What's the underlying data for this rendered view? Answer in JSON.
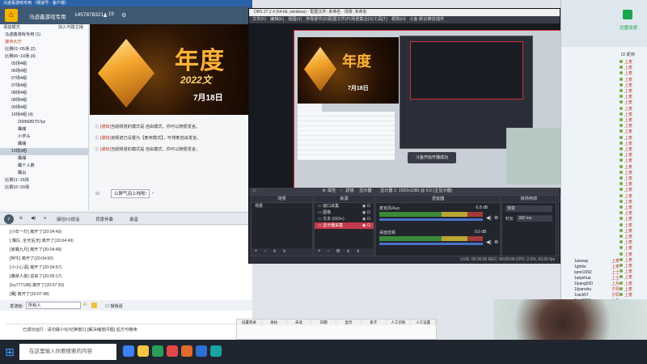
{
  "room": {
    "titlebar": "马迹看游戏专用 （频道号 - 客户端）",
    "name": "马迹鑫游戏专用",
    "room_id": "1457878321",
    "online_count": "19",
    "tree_header": "语音模式",
    "tree_header_right": "加入可踏主播",
    "tree": [
      {
        "label": "马迹鑫游戏专用 (1)",
        "cls": ""
      },
      {
        "label": "接待大厅",
        "cls": "red"
      },
      {
        "label": "比赛01~05场 (2)",
        "cls": ""
      },
      {
        "label": "比赛06~10场 (4)",
        "cls": ""
      },
      {
        "label": "05场4组",
        "cls": "sub"
      },
      {
        "label": "06场4组",
        "cls": "sub"
      },
      {
        "label": "07场4组",
        "cls": "sub"
      },
      {
        "label": "07场4组",
        "cls": "sub"
      },
      {
        "label": "08场4组",
        "cls": "sub"
      },
      {
        "label": "08场4组",
        "cls": "sub"
      },
      {
        "label": "09场4组",
        "cls": "sub"
      },
      {
        "label": "10场4组 (4)",
        "cls": "sub"
      },
      {
        "label": "2006689757pz",
        "cls": "sub2"
      },
      {
        "label": "鹰嘴",
        "cls": "sub2"
      },
      {
        "label": "小芋头",
        "cls": "sub2"
      },
      {
        "label": "鹰嘴",
        "cls": "sub2"
      },
      {
        "label": "10场3组",
        "cls": "sub sel"
      },
      {
        "label": "鹰嘴",
        "cls": "sub2"
      },
      {
        "label": "鹰个人数",
        "cls": "sub2"
      },
      {
        "label": "鹰白",
        "cls": "sub2"
      },
      {
        "label": "比赛11~15场",
        "cls": ""
      },
      {
        "label": "比赛16~20场",
        "cls": ""
      }
    ],
    "banner_title": "年度",
    "banner_year": "2022文",
    "banner_date": "7月18日",
    "chat_messages": [
      {
        "tag": "[通知]",
        "text": "当前频道的模式是 自由模式，你可以随便发言。"
      },
      {
        "tag": "[通知]",
        "text": "该频道已设置为【麦序模式】，可排麦自由发言。"
      },
      {
        "tag": "[通知]",
        "text": "当前频道的模式是 自由模式，你可以随便发言。"
      }
    ],
    "wheat_button": "公屏气泡上线啦!",
    "mic_bar": [
      "接住F2说话",
      "背景伴奏",
      "录音"
    ],
    "log_lines": [
      "[小年一灯] 离开了(20:04:49)",
      "[ 鹰队..全天后天] 离开了(20:04:49)",
      "[家鹰九月] 离开了(20:04:48)",
      "[阿牛] 离开了(20:04:50)",
      "[小小心语] 离开了(20:04:57)",
      "[鹰芽人俊] 进来了(20:05:17)",
      "[lvy777188] 离开了(20:07:30)",
      "[鹰] 离开了(20:07:48)"
    ],
    "send_label": "发送给:",
    "send_target": "所有人",
    "send_checkbox": "悄悄话",
    "notice_line": "已成功运行 -  请勿最小化/切换窗口 [解决缩放问题] 后方可继续"
  },
  "obs": {
    "titlebar": "OBS 27.2.4 (64-bit, windows) - 配置文件: 未命名 - 场景: 未命名",
    "menus": [
      "文件(F)",
      "编辑(E)",
      "视图(V)",
      "停靠部件(D)",
      "配置文件(P)",
      "场景集合(S)",
      "工具(T)",
      "帮助(H)",
      "斗鱼·新云推流插件"
    ],
    "status_items": [
      "属性",
      "滤镜",
      "显示器",
      "显示器 1: 1920x1080 @ 0,0 (主显示器)"
    ],
    "inner_title": "年度",
    "inner_date": "7月18日",
    "inner_popup": "斗鱼开始开播成功",
    "panels": {
      "scenes": {
        "head": "场景",
        "rows": [
          "场景"
        ]
      },
      "sources": {
        "head": "来源",
        "rows": [
          "窗口采集",
          "图像",
          "文本 (GDI+)",
          "显示器采集"
        ],
        "active_index": 3
      },
      "mixer": {
        "head": "混音器",
        "channels": [
          {
            "name": "麦克风/Aux",
            "db": "-5.8 dB"
          },
          {
            "name": "桌面音频",
            "db": "0.0 dB"
          }
        ]
      },
      "transitions": {
        "head": "转场特效",
        "type": "渐变",
        "duration_label": "时长",
        "duration": "300 ms"
      },
      "controls": {
        "head": "控件",
        "buttons": [
          "开始推流",
          "开始录制",
          "启动虚拟摄像机",
          "工作室模式",
          "设置",
          "退出"
        ]
      }
    },
    "bottom_status": "LIVE: 00:00:00   REC: 00:00:00   CPU: 2.0%, 60.00 fps"
  },
  "ulist": {
    "brand": "迅雷加速",
    "col_head": "ID 昵称",
    "rows": [
      "上麦",
      "上麦",
      "上麦",
      "上麦",
      "上麦",
      "上麦",
      "上麦",
      "上麦",
      "上麦",
      "上麦",
      "上麦",
      "上麦",
      "上麦",
      "上麦",
      "上麦",
      "上麦",
      "上麦",
      "上麦",
      "上麦",
      "上麦",
      "上麦",
      "上麦",
      "上麦",
      "上麦",
      "上麦",
      "上麦",
      "上麦",
      "上麦",
      "上麦",
      "上麦",
      "上麦",
      "上麦",
      "上麦",
      "上麦",
      "上麦",
      "上麦",
      "上麦",
      "上麦",
      "上麦",
      "上麦",
      "上麦"
    ],
    "names": [
      {
        "name": "1anway",
        "tail": "上麦"
      },
      {
        "name": "1ghitw",
        "tail": "上麦"
      },
      {
        "name": "lanni1992",
        "tail": "上士"
      },
      {
        "name": "1atyehua",
        "tail": "上士"
      },
      {
        "name": "1lyang020",
        "tail": "上兵"
      },
      {
        "name": "1ilyanshu",
        "tail": "夕阳"
      },
      {
        "name": "1rack57",
        "tail": "夕阳"
      },
      {
        "name": "1lub0299",
        "tail": "小鱼"
      }
    ]
  },
  "table": {
    "headers": [
      "设置目录",
      "发帖",
      "未读",
      "日期",
      "显示",
      "盖子",
      "人工识别",
      "人工设置"
    ]
  },
  "taskbar": {
    "search_placeholder": "在这里输入你要搜索的内容"
  }
}
